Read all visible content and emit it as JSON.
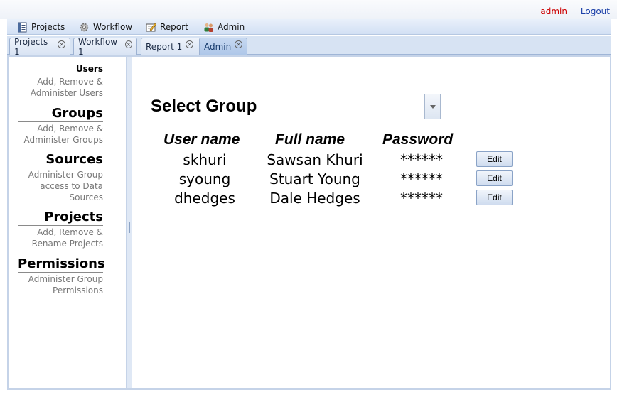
{
  "topbar": {
    "user": "admin",
    "logout": "Logout"
  },
  "menu": [
    {
      "label": "Projects",
      "icon": "projects-icon"
    },
    {
      "label": "Workflow",
      "icon": "gear-icon"
    },
    {
      "label": "Report",
      "icon": "report-icon"
    },
    {
      "label": "Admin",
      "icon": "admin-users-icon"
    }
  ],
  "tabs": [
    {
      "label": "Projects 1",
      "active": false
    },
    {
      "label": "Workflow 1",
      "active": false
    },
    {
      "label": "Report 1",
      "active": false
    },
    {
      "label": "Admin",
      "active": true
    }
  ],
  "sidebar": [
    {
      "title": "Users",
      "desc": [
        "Add, Remove &",
        "Administer Users"
      ]
    },
    {
      "title": "Groups",
      "desc": [
        "Add, Remove &",
        "Administer Groups"
      ]
    },
    {
      "title": "Sources",
      "desc": [
        "Administer Group",
        "access to Data",
        "Sources"
      ]
    },
    {
      "title": "Projects",
      "desc": [
        "Add, Remove &",
        "Rename Projects"
      ]
    },
    {
      "title": "Permissions",
      "desc": [
        "Administer Group",
        "Permissions"
      ]
    }
  ],
  "main": {
    "select_label": "Select Group",
    "select_value": "",
    "columns": [
      "User name",
      "Full name",
      "Password"
    ],
    "edit_label": "Edit",
    "rows": [
      {
        "username": "skhuri",
        "fullname": "Sawsan Khuri",
        "password": "******"
      },
      {
        "username": "syoung",
        "fullname": "Stuart Young",
        "password": "******"
      },
      {
        "username": "dhedges",
        "fullname": "Dale Hedges",
        "password": "******"
      }
    ]
  }
}
